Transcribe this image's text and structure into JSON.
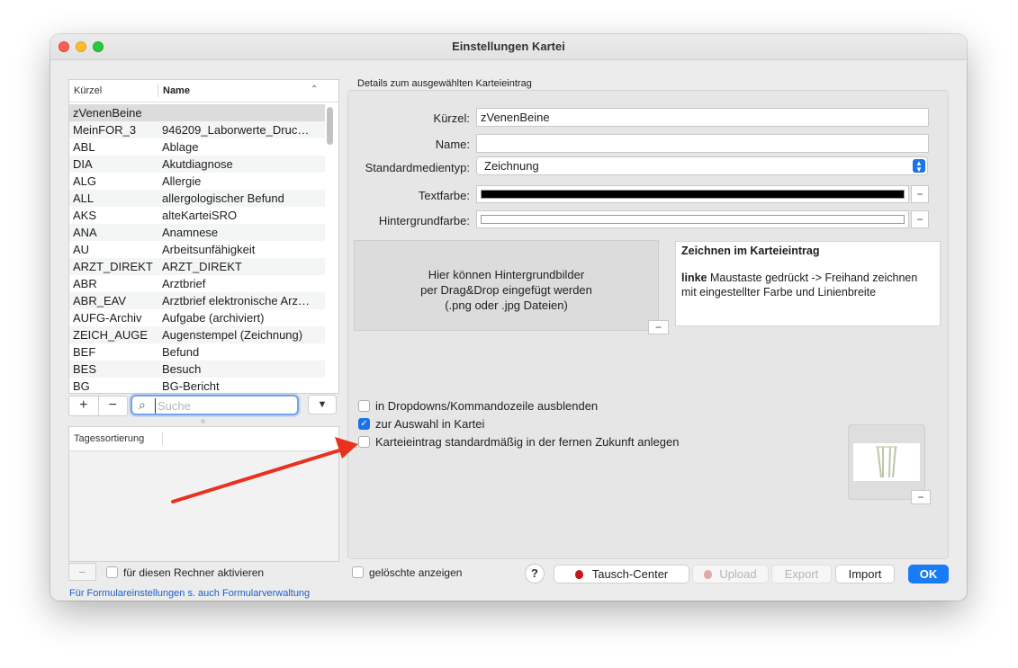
{
  "window": {
    "title": "Einstellungen Kartei"
  },
  "list": {
    "col_kuerzel": "Kürzel",
    "col_name": "Name",
    "rows": [
      {
        "k": "zVenenBeine",
        "n": ""
      },
      {
        "k": "MeinFOR_3",
        "n": "946209_Laborwerte_Druc…"
      },
      {
        "k": "ABL",
        "n": "Ablage"
      },
      {
        "k": "DIA",
        "n": "Akutdiagnose"
      },
      {
        "k": "ALG",
        "n": "Allergie"
      },
      {
        "k": "ALL",
        "n": "allergologischer Befund"
      },
      {
        "k": "AKS",
        "n": "alteKarteiSRO"
      },
      {
        "k": "ANA",
        "n": "Anamnese"
      },
      {
        "k": "AU",
        "n": "Arbeitsunfähigkeit"
      },
      {
        "k": "ARZT_DIREKT",
        "n": "ARZT_DIREKT"
      },
      {
        "k": "ABR",
        "n": "Arztbrief"
      },
      {
        "k": "ABR_EAV",
        "n": "Arztbrief elektronische Arz…"
      },
      {
        "k": "AUFG-Archiv",
        "n": "Aufgabe (archiviert)"
      },
      {
        "k": "ZEICH_AUGE",
        "n": "Augenstempel (Zeichnung)"
      },
      {
        "k": "BEF",
        "n": "Befund"
      },
      {
        "k": "BES",
        "n": "Besuch"
      },
      {
        "k": "BG",
        "n": "BG-Bericht"
      }
    ]
  },
  "search": {
    "placeholder": "Suche"
  },
  "sort": {
    "header": "Tagessortierung"
  },
  "left_footer": {
    "activate_label": "für diesen Rechner aktivieren",
    "link": "Für Formulareinstellungen s. auch Formularverwaltung"
  },
  "details": {
    "section_label": "Details zum ausgewählten Karteieintrag",
    "kuerzel_label": "Kürzel:",
    "kuerzel_value": "zVenenBeine",
    "name_label": "Name:",
    "name_value": "",
    "medientyp_label": "Standardmedientyp:",
    "medientyp_value": "Zeichnung",
    "textfarbe_label": "Textfarbe:",
    "textfarbe_color": "#000000",
    "hintergrund_label": "Hintergrundfarbe:",
    "hintergrund_color": "#ffffff",
    "dropzone_line1": "Hier können Hintergrundbilder",
    "dropzone_line2": "per Drag&Drop eingefügt werden",
    "dropzone_line3": "(.png oder .jpg Dateien)",
    "info_title": "Zeichnen im Karteieintrag",
    "info_bold": "linke",
    "info_text": " Maustaste gedrückt -> Freihand zeichnen mit eingestellter Farbe und Linienbreite",
    "cb_hide_label": "in Dropdowns/Kommandozeile ausblenden",
    "cb_hide": false,
    "cb_auswahl_label": "zur Auswahl in Kartei",
    "cb_auswahl": true,
    "cb_zukunft_label": "Karteieintrag standardmäßig in der fernen Zukunft anlegen",
    "cb_zukunft": false
  },
  "footer": {
    "deleted_label": "gelöschte anzeigen",
    "help": "?",
    "tausch": "Tausch-Center",
    "upload": "Upload",
    "export": "Export",
    "import": "Import",
    "ok": "OK"
  },
  "colors": {
    "accent": "#1a7cf5",
    "arrow": "#e8321e",
    "apple_red": "#c8151b"
  }
}
